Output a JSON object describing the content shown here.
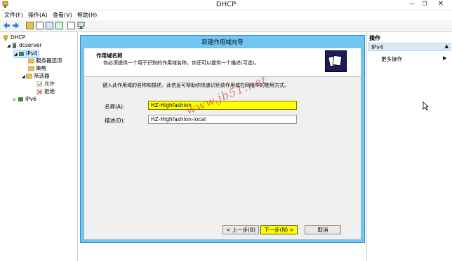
{
  "window": {
    "title": "DHCP",
    "icon": "dhcp-app-icon"
  },
  "menubar": {
    "items": [
      "文件(F)",
      "操作(A)",
      "查看(V)",
      "帮助(H)"
    ]
  },
  "toolbar": {
    "icons": [
      "back-arrow-icon",
      "forward-arrow-icon",
      "up-folder-icon",
      "show-tree-icon",
      "properties-icon",
      "refresh-icon",
      "help-icon",
      "monitor-icon"
    ]
  },
  "tree": {
    "items": [
      {
        "label": "DHCP",
        "icon": "dhcp-icon"
      },
      {
        "label": "dcserver",
        "icon": "server-icon"
      },
      {
        "label": "IPv4",
        "icon": "ipv4-icon",
        "selected": true
      },
      {
        "label": "服务器选项",
        "icon": "options-icon"
      },
      {
        "label": "策略",
        "icon": "policy-icon"
      },
      {
        "label": "筛选器",
        "icon": "filter-icon"
      },
      {
        "label": "允许",
        "icon": "allow-icon"
      },
      {
        "label": "拒绝",
        "icon": "deny-icon"
      },
      {
        "label": "IPv6",
        "icon": "ipv6-icon"
      }
    ]
  },
  "wizard": {
    "title": "新建作用域向导",
    "heading": "作用域名称",
    "subheading": "你必须提供一个用于识别的作用域名称。你还可以提供一个描述(可选)。",
    "instruction": "键入此作用域的名称和描述。此信息可帮助你快速识别该作用域在网络中的使用方式。",
    "name_label": "名称(A):",
    "name_value": "HZ-Highfashion",
    "desc_label": "描述(D):",
    "desc_value": "HZ-Highfashion-local",
    "back_button": "< 上一步(B)",
    "next_button": "下一步(N) >",
    "cancel_button": "取消",
    "highlight_color": "#ffff00"
  },
  "actions": {
    "title": "操作",
    "section": "IPv4",
    "more": "更多操作"
  },
  "watermark": "www.jb51.net"
}
